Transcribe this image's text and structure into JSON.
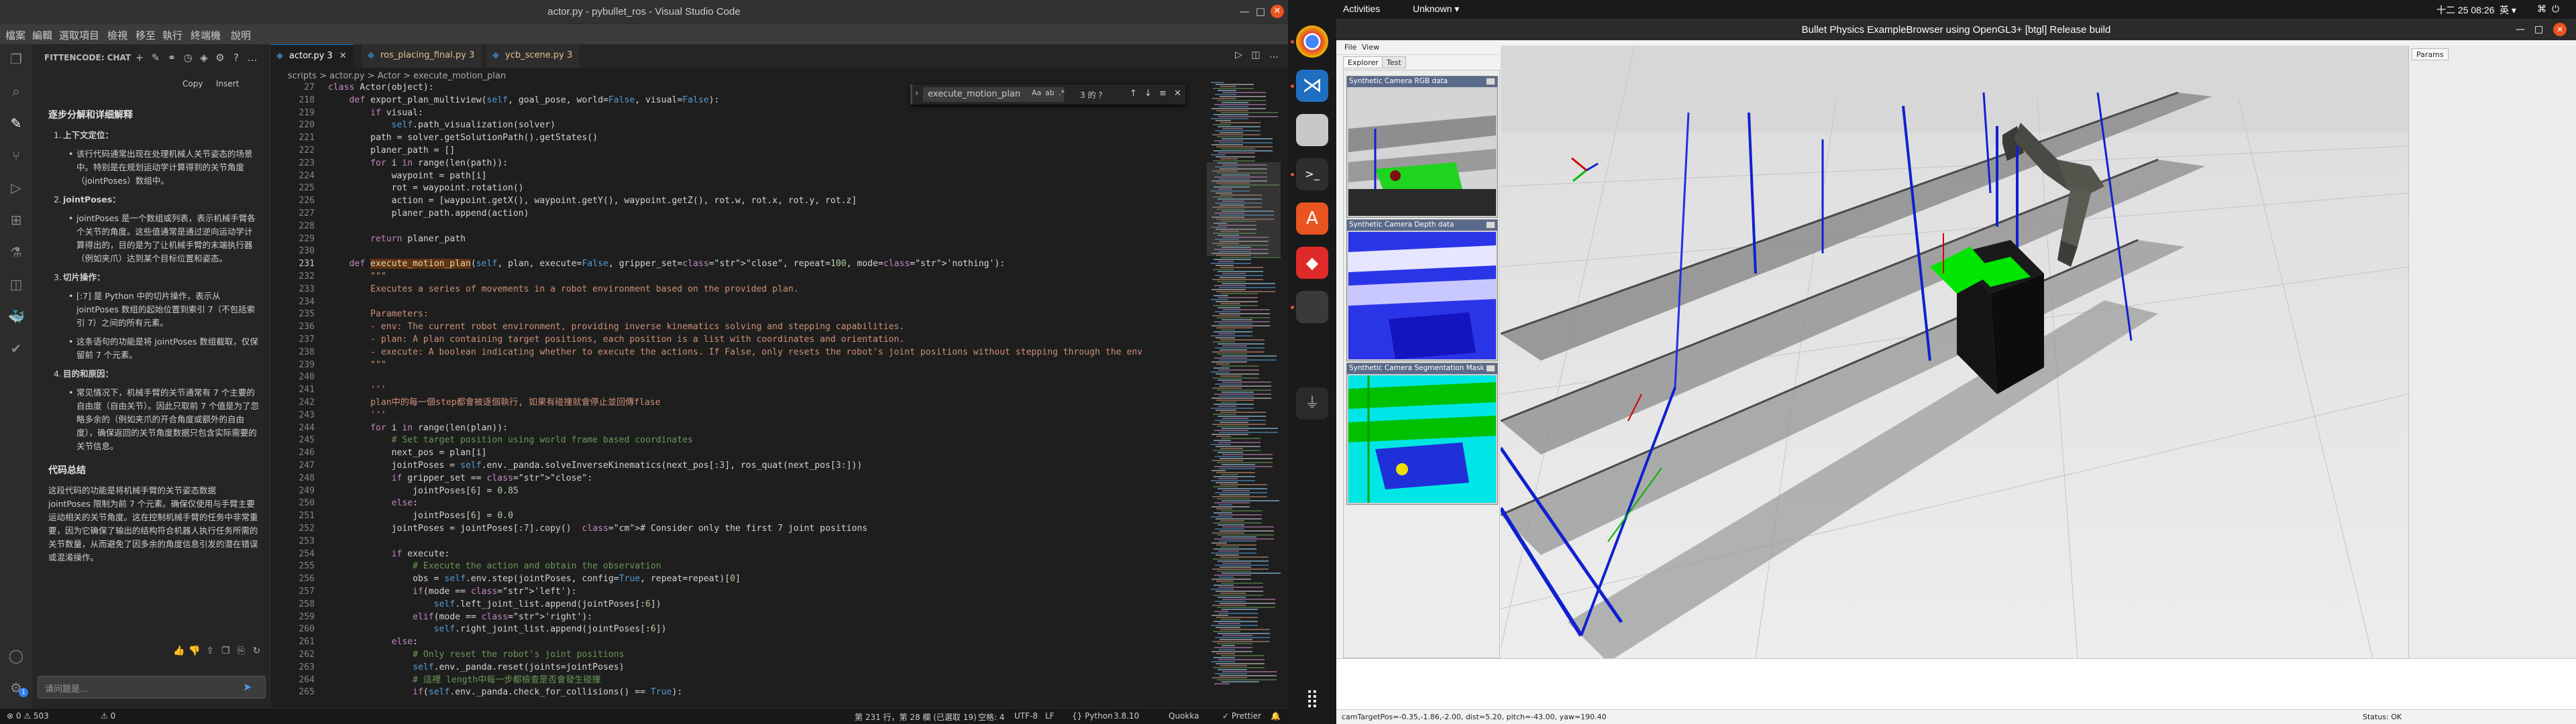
{
  "vscode": {
    "window_title": "actor.py - pybullet_ros - Visual Studio Code",
    "menu": [
      "檔案",
      "編輯",
      "選取項目",
      "檢視",
      "移至",
      "執行",
      "終端機",
      "說明"
    ],
    "chat": {
      "header": "FITTENCODE: CHAT",
      "copy": "Copy",
      "insert": "Insert",
      "section1": "逐步分解和详细解释",
      "items": [
        {
          "n": "1.",
          "title": "上下文定位：",
          "text": "该行代码通常出现在处理机械人关节姿态的场景中。特别是在规划运动学计算得到的关节角度（jointPoses）数组中。"
        },
        {
          "n": "2.",
          "title": "jointPoses：",
          "text": "jointPoses 是一个数组或列表，表示机械手臂各个关节的角度。这些值通常是通过逆向运动学计算得出的，目的是为了让机械手臂的末端执行器（例如夹爪）达到某个目标位置和姿态。"
        },
        {
          "n": "3.",
          "title": "切片操作：",
          "text": "[:7] 是 Python 中的切片操作，表示从 jointPoses 数组的起始位置到索引 7（不包括索引 7）之间的所有元素。",
          "extra": "这条语句的功能是将 jointPoses 数组截取，仅保留前 7 个元素。"
        },
        {
          "n": "4.",
          "title": "目的和原因：",
          "text": "常见情况下，机械手臂的关节通常有 7 个主要的自由度（自由关节）。因此只取前 7 个值是为了忽略多余的（例如夹爪的开合角度或额外的自由度），确保返回的关节角度数据只包含实际需要的关节信息。"
        }
      ],
      "section2": "代码总结",
      "summary": "这段代码的功能是将机械手臂的关节姿态数据 jointPoses 限制为前 7 个元素。确保仅使用与手臂主要运动相关的关节角度。这在控制机械手臂的任务中非常重要，因为它确保了输出的结构符合机器人执行任务所需的关节数量，从而避免了因多余的角度信息引发的潜在错误或混淆操作。",
      "input_placeholder": "请问题是..."
    },
    "tabs": [
      {
        "label": "actor.py 3",
        "active": true
      },
      {
        "label": "ros_placing_final.py 3",
        "active": false
      },
      {
        "label": "ycb_scene.py 3",
        "active": false
      }
    ],
    "breadcrumb": "scripts > actor.py > Actor > execute_motion_plan",
    "find": {
      "query": "execute_motion_plan",
      "count": "3 的 ?",
      "opt1": "Aa",
      "opt2": "ab",
      "opt3": ".*"
    },
    "lines": [
      {
        "n": "27",
        "code": "class Actor(object):"
      },
      {
        "n": "218",
        "code": "    def export_plan_multiview(self, goal_pose, world=False, visual=False):"
      },
      {
        "n": "219",
        "code": "        if visual:"
      },
      {
        "n": "220",
        "code": "            self.path_visualization(solver)"
      },
      {
        "n": "221",
        "code": "        path = solver.getSolutionPath().getStates()"
      },
      {
        "n": "222",
        "code": "        planer_path = []"
      },
      {
        "n": "223",
        "code": "        for i in range(len(path)):"
      },
      {
        "n": "224",
        "code": "            waypoint = path[i]"
      },
      {
        "n": "225",
        "code": "            rot = waypoint.rotation()"
      },
      {
        "n": "226",
        "code": "            action = [waypoint.getX(), waypoint.getY(), waypoint.getZ(), rot.w, rot.x, rot.y, rot.z]"
      },
      {
        "n": "227",
        "code": "            planer_path.append(action)"
      },
      {
        "n": "228",
        "code": ""
      },
      {
        "n": "229",
        "code": "        return planer_path"
      },
      {
        "n": "230",
        "code": ""
      },
      {
        "n": "231",
        "code": "    def execute_motion_plan(self, plan, execute=False, gripper_set=\"close\", repeat=100, mode='nothing'):"
      },
      {
        "n": "232",
        "code": "        \"\"\""
      },
      {
        "n": "233",
        "code": "        Executes a series of movements in a robot environment based on the provided plan."
      },
      {
        "n": "234",
        "code": ""
      },
      {
        "n": "235",
        "code": "        Parameters:"
      },
      {
        "n": "236",
        "code": "        - env: The current robot environment, providing inverse kinematics solving and stepping capabilities."
      },
      {
        "n": "237",
        "code": "        - plan: A plan containing target positions, each position is a list with coordinates and orientation."
      },
      {
        "n": "238",
        "code": "        - execute: A boolean indicating whether to execute the actions. If False, only resets the robot's joint positions without stepping through the env"
      },
      {
        "n": "239",
        "code": "        \"\"\""
      },
      {
        "n": "240",
        "code": ""
      },
      {
        "n": "241",
        "code": "        '''"
      },
      {
        "n": "242",
        "code": "        plan中的每一個step都會被逐個執行, 如果有碰撞就會停止並回傳flase"
      },
      {
        "n": "243",
        "code": "        '''"
      },
      {
        "n": "244",
        "code": "        for i in range(len(plan)):"
      },
      {
        "n": "245",
        "code": "            # Set target position using world frame based coordinates"
      },
      {
        "n": "246",
        "code": "            next_pos = plan[i]"
      },
      {
        "n": "247",
        "code": "            jointPoses = self.env._panda.solveInverseKinematics(next_pos[:3], ros_quat(next_pos[3:]))"
      },
      {
        "n": "248",
        "code": "            if gripper_set == \"close\":"
      },
      {
        "n": "249",
        "code": "                jointPoses[6] = 0.85"
      },
      {
        "n": "250",
        "code": "            else:"
      },
      {
        "n": "251",
        "code": "                jointPoses[6] = 0.0"
      },
      {
        "n": "252",
        "code": "            jointPoses = jointPoses[:7].copy()  # Consider only the first 7 joint positions"
      },
      {
        "n": "253",
        "code": ""
      },
      {
        "n": "254",
        "code": "            if execute:"
      },
      {
        "n": "255",
        "code": "                # Execute the action and obtain the observation"
      },
      {
        "n": "256",
        "code": "                obs = self.env.step(jointPoses, config=True, repeat=repeat)[0]"
      },
      {
        "n": "257",
        "code": "                if(mode == 'left'):"
      },
      {
        "n": "258",
        "code": "                    self.left_joint_list.append(jointPoses[:6])"
      },
      {
        "n": "259",
        "code": "                elif(mode == 'right'):"
      },
      {
        "n": "260",
        "code": "                    self.right_joint_list.append(jointPoses[:6])"
      },
      {
        "n": "261",
        "code": "            else:"
      },
      {
        "n": "262",
        "code": "                # Only reset the robot's joint positions"
      },
      {
        "n": "263",
        "code": "                self.env._panda.reset(joints=jointPoses)"
      },
      {
        "n": "264",
        "code": "                # 這裡 length中每一步都檢查是否會發生碰撞"
      },
      {
        "n": "265",
        "code": "                if(self.env._panda.check_for_collisions() == True):"
      }
    ],
    "status": {
      "left": "⊗ 0 ⚠ 503",
      "warn2": "⚠ 0",
      "pos": "第 231 行，第 28 欄 (已選取 19)",
      "spaces": "空格: 4",
      "enc": "UTF-8",
      "eol": "LF",
      "lang": "{} Python",
      "ver": "3.8.10",
      "quokka": "Quokka",
      "prettier": "✓ Prettier"
    }
  },
  "gnome": {
    "activities": "Activities",
    "app": "Unknown ▾",
    "clock": "十二 25  08:26",
    "lang": "英 ▾"
  },
  "bullet": {
    "title": "Bullet Physics ExampleBrowser using OpenGL3+ [btgl] Release build",
    "menu": [
      "File",
      "View"
    ],
    "tabs": [
      "Explorer",
      "Test"
    ],
    "params_tab": "Params",
    "cams": [
      {
        "title": "Synthetic Camera RGB data"
      },
      {
        "title": "Synthetic Camera Depth data"
      },
      {
        "title": "Synthetic Camera Segmentation Mask"
      }
    ],
    "status_left": "camTargetPos=-0.35,-1.86,-2.00, dist=5.20, pitch=-43.00, yaw=190.40",
    "status_right": "Status: OK"
  },
  "colors": {
    "vscode_bg": "#1e1e1e",
    "highlight": "#613214",
    "accent": "#0078d4",
    "robot_green": "#00e600",
    "robot_blue": "#0000ff"
  }
}
